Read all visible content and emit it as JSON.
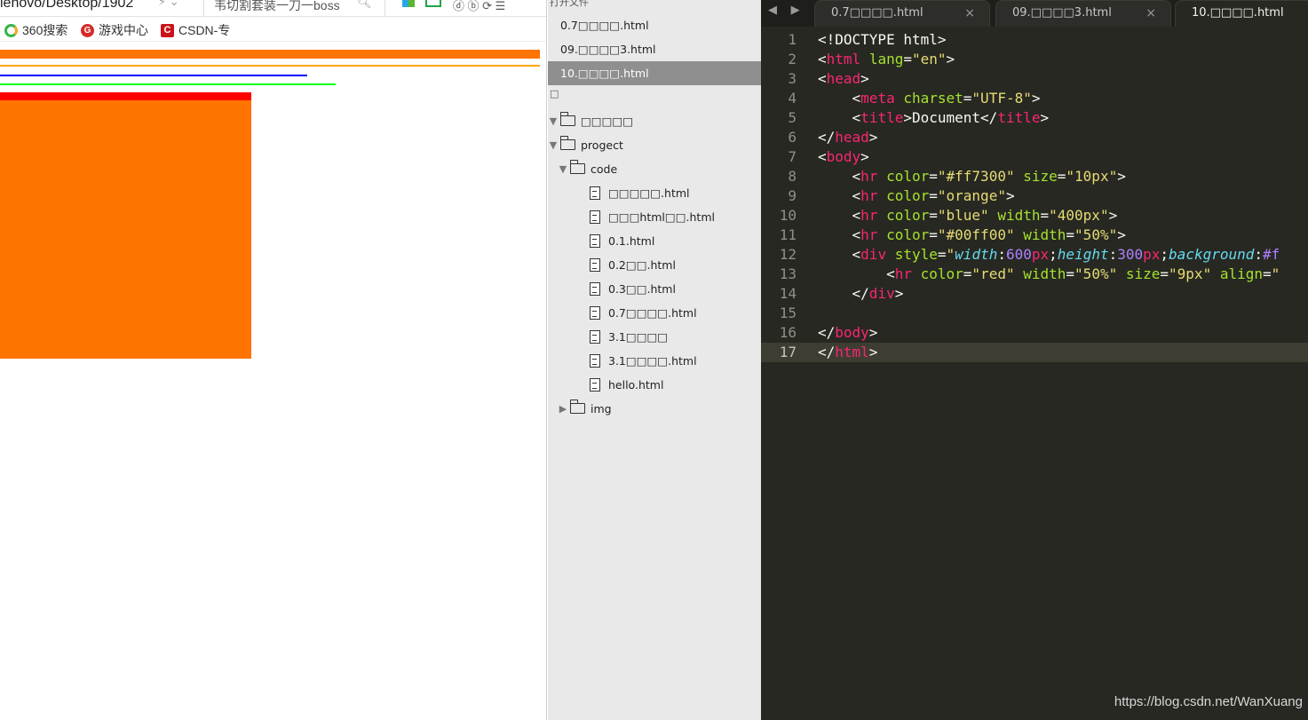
{
  "browser": {
    "address": "lenovo/Desktop/1902",
    "address_icons": "⚡ ⌄",
    "search_text": "韦切割套装一刀一boss",
    "toolbar_misc": "ⓓ ⓑ ⟳ ☰",
    "bookmarks": [
      {
        "label": "360搜索",
        "icon": "360-icon"
      },
      {
        "label": "游戏中心",
        "icon": "game-icon"
      },
      {
        "label": "CSDN-专",
        "icon": "csdn-icon"
      }
    ],
    "rendered_page": {
      "hr_colors": [
        "#ff7300",
        "orange",
        "blue",
        "#00ff00",
        "red"
      ],
      "div_background": "#ff7300"
    }
  },
  "sidebar": {
    "header": "打开文件",
    "open_files": [
      "0.7□□□□.html",
      "09.□□□□3.html",
      "10.□□□□.html"
    ],
    "folders_header": "□",
    "tree": [
      {
        "label": "□□□□□",
        "type": "folder",
        "level": 0,
        "expanded": true
      },
      {
        "label": "progect",
        "type": "folder",
        "level": 0,
        "expanded": true
      },
      {
        "label": "code",
        "type": "folder",
        "level": 1,
        "expanded": true
      },
      {
        "label": "□□□□□.html",
        "type": "file",
        "level": 2
      },
      {
        "label": "□□□html□□.html",
        "type": "file",
        "level": 2
      },
      {
        "label": "0.1.html",
        "type": "file",
        "level": 2
      },
      {
        "label": "0.2□□.html",
        "type": "file",
        "level": 2
      },
      {
        "label": "0.3□□.html",
        "type": "file",
        "level": 2
      },
      {
        "label": "0.7□□□□.html",
        "type": "file",
        "level": 2
      },
      {
        "label": "3.1□□□□",
        "type": "file",
        "level": 2
      },
      {
        "label": "3.1□□□□.html",
        "type": "file",
        "level": 2
      },
      {
        "label": "hello.html",
        "type": "file",
        "level": 2
      },
      {
        "label": "img",
        "type": "folder",
        "level": 1,
        "expanded": false
      }
    ]
  },
  "editor": {
    "nav_arrows": "◀ ▶",
    "tabs": [
      {
        "label": "0.7□□□□.html",
        "active": false
      },
      {
        "label": "09.□□□□3.html",
        "active": false
      },
      {
        "label": "10.□□□□.html",
        "active": true
      }
    ],
    "close_glyph": "×",
    "active_line": 17,
    "lines": [
      [
        [
          "pt",
          "<!DOCTYPE html>"
        ]
      ],
      [
        [
          "pt",
          "<"
        ],
        [
          "tg",
          "html"
        ],
        [
          "pt",
          " "
        ],
        [
          "at",
          "lang"
        ],
        [
          "pt",
          "="
        ],
        [
          "st",
          "\"en\""
        ],
        [
          "pt",
          ">"
        ]
      ],
      [
        [
          "pt",
          "<"
        ],
        [
          "tg",
          "head"
        ],
        [
          "pt",
          ">"
        ]
      ],
      [
        [
          "pt",
          "    <"
        ],
        [
          "tg",
          "meta"
        ],
        [
          "pt",
          " "
        ],
        [
          "at",
          "charset"
        ],
        [
          "pt",
          "="
        ],
        [
          "st",
          "\"UTF-8\""
        ],
        [
          "pt",
          ">"
        ]
      ],
      [
        [
          "pt",
          "    <"
        ],
        [
          "tg",
          "title"
        ],
        [
          "pt",
          ">Document</"
        ],
        [
          "tg",
          "title"
        ],
        [
          "pt",
          ">"
        ]
      ],
      [
        [
          "pt",
          "</"
        ],
        [
          "tg",
          "head"
        ],
        [
          "pt",
          ">"
        ]
      ],
      [
        [
          "pt",
          "<"
        ],
        [
          "tg",
          "body"
        ],
        [
          "pt",
          ">"
        ]
      ],
      [
        [
          "pt",
          "    <"
        ],
        [
          "tg",
          "hr"
        ],
        [
          "pt",
          " "
        ],
        [
          "at",
          "color"
        ],
        [
          "pt",
          "="
        ],
        [
          "st",
          "\"#ff7300\""
        ],
        [
          "pt",
          " "
        ],
        [
          "at",
          "size"
        ],
        [
          "pt",
          "="
        ],
        [
          "st",
          "\"10px\""
        ],
        [
          "pt",
          ">"
        ]
      ],
      [
        [
          "pt",
          "    <"
        ],
        [
          "tg",
          "hr"
        ],
        [
          "pt",
          " "
        ],
        [
          "at",
          "color"
        ],
        [
          "pt",
          "="
        ],
        [
          "st",
          "\"orange\""
        ],
        [
          "pt",
          ">"
        ]
      ],
      [
        [
          "pt",
          "    <"
        ],
        [
          "tg",
          "hr"
        ],
        [
          "pt",
          " "
        ],
        [
          "at",
          "color"
        ],
        [
          "pt",
          "="
        ],
        [
          "st",
          "\"blue\""
        ],
        [
          "pt",
          " "
        ],
        [
          "at",
          "width"
        ],
        [
          "pt",
          "="
        ],
        [
          "st",
          "\"400px\""
        ],
        [
          "pt",
          ">"
        ]
      ],
      [
        [
          "pt",
          "    <"
        ],
        [
          "tg",
          "hr"
        ],
        [
          "pt",
          " "
        ],
        [
          "at",
          "color"
        ],
        [
          "pt",
          "="
        ],
        [
          "st",
          "\"#00ff00\""
        ],
        [
          "pt",
          " "
        ],
        [
          "at",
          "width"
        ],
        [
          "pt",
          "="
        ],
        [
          "st",
          "\"50%\""
        ],
        [
          "pt",
          ">"
        ]
      ],
      [
        [
          "pt",
          "    <"
        ],
        [
          "tg",
          "div"
        ],
        [
          "pt",
          " "
        ],
        [
          "at",
          "style"
        ],
        [
          "pt",
          "="
        ],
        [
          "st",
          "\""
        ],
        [
          "sk",
          "width"
        ],
        [
          "pt",
          ":"
        ],
        [
          "sv",
          "600"
        ],
        [
          "tg",
          "px"
        ],
        [
          "pt",
          ";"
        ],
        [
          "sk",
          "height"
        ],
        [
          "pt",
          ":"
        ],
        [
          "sv",
          "300"
        ],
        [
          "tg",
          "px"
        ],
        [
          "pt",
          ";"
        ],
        [
          "sk",
          "background"
        ],
        [
          "pt",
          ":"
        ],
        [
          "sv",
          "#f"
        ]
      ],
      [
        [
          "pt",
          "        <"
        ],
        [
          "tg",
          "hr"
        ],
        [
          "pt",
          " "
        ],
        [
          "at",
          "color"
        ],
        [
          "pt",
          "="
        ],
        [
          "st",
          "\"red\""
        ],
        [
          "pt",
          " "
        ],
        [
          "at",
          "width"
        ],
        [
          "pt",
          "="
        ],
        [
          "st",
          "\"50%\""
        ],
        [
          "pt",
          " "
        ],
        [
          "at",
          "size"
        ],
        [
          "pt",
          "="
        ],
        [
          "st",
          "\"9px\""
        ],
        [
          "pt",
          " "
        ],
        [
          "at",
          "align"
        ],
        [
          "pt",
          "="
        ],
        [
          "st",
          "\""
        ]
      ],
      [
        [
          "pt",
          "    </"
        ],
        [
          "tg",
          "div"
        ],
        [
          "pt",
          ">"
        ]
      ],
      [
        [
          "pt",
          ""
        ]
      ],
      [
        [
          "pt",
          "</"
        ],
        [
          "tg",
          "body"
        ],
        [
          "pt",
          ">"
        ]
      ],
      [
        [
          "pt",
          "</"
        ],
        [
          "tg",
          "html"
        ],
        [
          "pt",
          ">"
        ]
      ]
    ]
  },
  "watermark": "https://blog.csdn.net/WanXuang"
}
